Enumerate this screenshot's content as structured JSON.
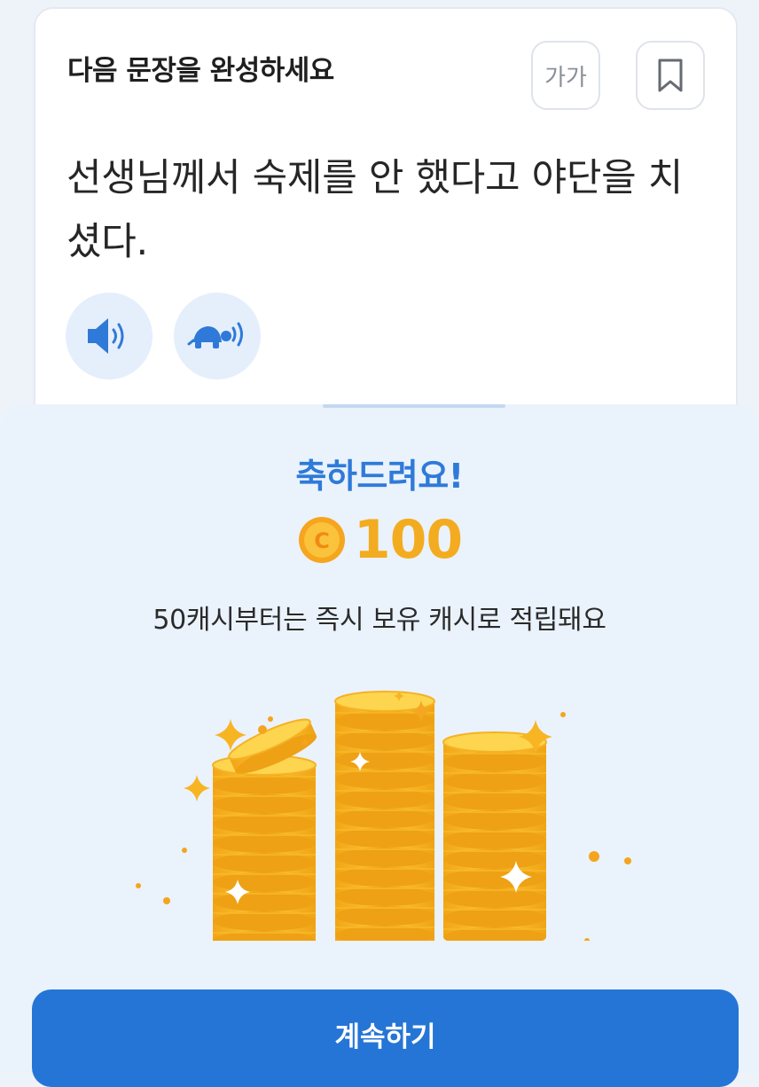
{
  "quiz": {
    "title": "다음 문장을 완성하세요",
    "font_size_label": "가가",
    "sentence": "선생님께서 숙제를 안 했다고 야단을 치셨다."
  },
  "reward_modal": {
    "congrats": "축하드려요!",
    "coin_label": "C",
    "amount": "100",
    "subtext": "50캐시부터는 즉시 보유 캐시로 적립돼요",
    "illustration": "gold-coin-stacks-with-sparkles"
  },
  "continue_label": "계속하기",
  "colors": {
    "accent": "#2575d6",
    "title_blue": "#2f7ad8",
    "coin_gold": "#f3ac1f",
    "modal_bg": "#eaf2fc"
  }
}
